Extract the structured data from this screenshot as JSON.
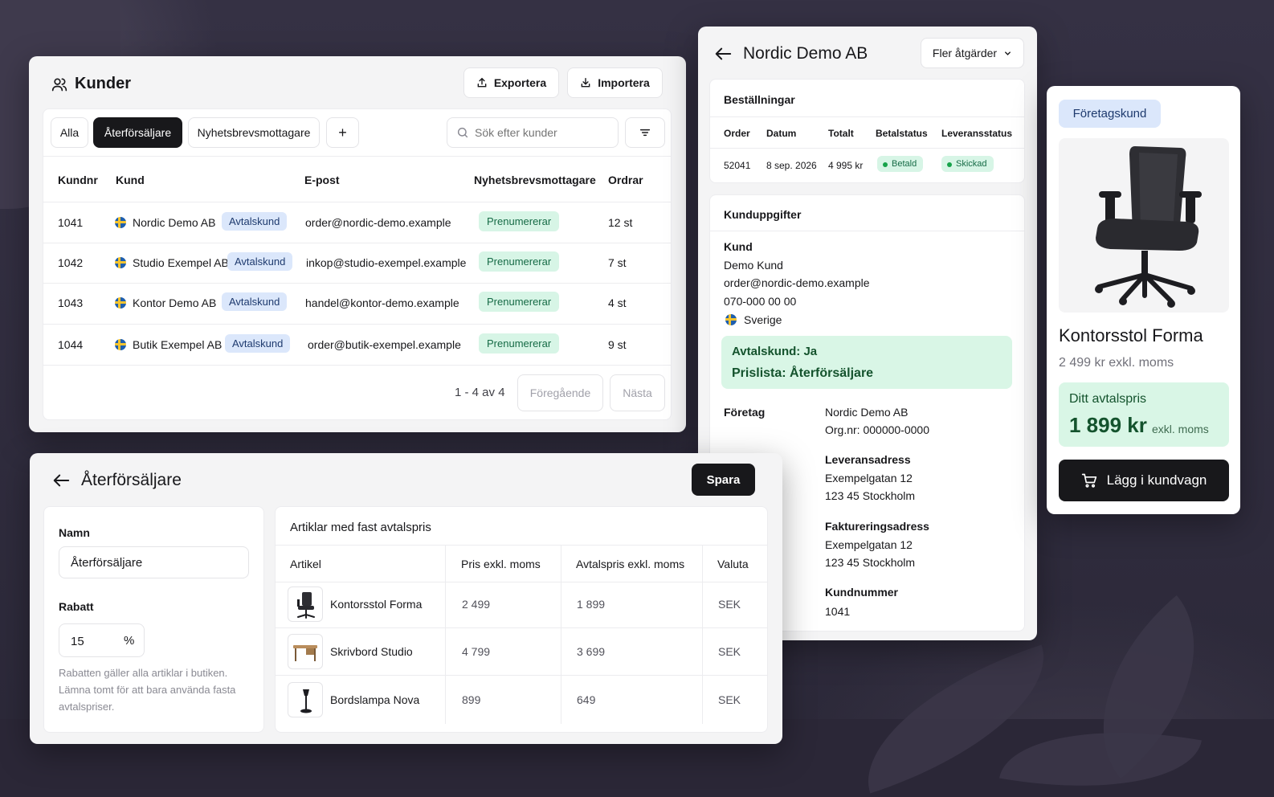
{
  "customers_panel": {
    "title": "Kunder",
    "export_label": "Exportera",
    "import_label": "Importera",
    "filters": [
      "Alla",
      "Återförsäljare",
      "Nyhetsbrevsmottagare"
    ],
    "add_filter": "+",
    "search_placeholder": "Sök efter kunder",
    "columns": [
      "Kundnr",
      "Kund",
      "E-post",
      "Nyhetsbrevsmottagare",
      "Ordrar"
    ],
    "rows": [
      {
        "id": "1041",
        "name": "Nordic Demo AB",
        "tag": "Avtalskund",
        "email": "order@nordic-demo.example",
        "newsletter": "Prenumererar",
        "orders": "12 st"
      },
      {
        "id": "1042",
        "name": "Studio Exempel AB",
        "tag": "Avtalskund",
        "email": "inkop@studio-exempel.example",
        "newsletter": "Prenumererar",
        "orders": "7 st"
      },
      {
        "id": "1043",
        "name": "Kontor Demo AB",
        "tag": "Avtalskund",
        "email": "handel@kontor-demo.example",
        "newsletter": "Prenumererar",
        "orders": "4 st"
      },
      {
        "id": "1044",
        "name": "Butik Exempel AB",
        "tag": "Avtalskund",
        "email": "order@butik-exempel.example",
        "newsletter": "Prenumererar",
        "orders": "9 st"
      }
    ],
    "pagination": {
      "range": "1 - 4 av 4",
      "prev": "Föregående",
      "next": "Nästa"
    }
  },
  "customer_detail": {
    "title": "Nordic Demo AB",
    "more_actions": "Fler åtgärder",
    "orders_heading": "Beställningar",
    "orders_columns": [
      "Order",
      "Datum",
      "Totalt",
      "Betalstatus",
      "Leveransstatus"
    ],
    "order": {
      "id": "52041",
      "date": "8 sep. 2026",
      "total": "4 995 kr",
      "payment": "Betald",
      "delivery": "Skickad"
    },
    "details_heading": "Kunduppgifter",
    "kund_label": "Kund",
    "kund_name": "Demo Kund",
    "kund_email": "order@nordic-demo.example",
    "kund_phone": "070-000 00 00",
    "kund_country": "Sverige",
    "agreement": "Avtalskund: Ja",
    "pricelist": "Prislista: Återförsäljare",
    "company_label": "Företag",
    "company_name": "Nordic Demo AB",
    "org_nr": "Org.nr: 000000-0000",
    "delivery_label": "Leveransadress",
    "delivery_street": "Exempelgatan 12",
    "delivery_city": "123 45 Stockholm",
    "billing_label": "Faktureringsadress",
    "billing_street": "Exempelgatan 12",
    "billing_city": "123 45 Stockholm",
    "custnum_label": "Kundnummer",
    "custnum": "1041"
  },
  "product_card": {
    "badge": "Företagskund",
    "name": "Kontorsstol Forma",
    "list_price": "2 499 kr exkl. moms",
    "deal_label": "Ditt avtalspris",
    "deal_price": "1 899 kr",
    "deal_suffix": "exkl. moms",
    "cart_button": "Lägg i kundvagn"
  },
  "pricelist_panel": {
    "title": "Återförsäljare",
    "save": "Spara",
    "name_label": "Namn",
    "name_value": "Återförsäljare",
    "discount_label": "Rabatt",
    "discount_value": "15",
    "discount_unit": "%",
    "discount_help": "Rabatten gäller alla artiklar i butiken. Lämna tomt för att bara använda fasta avtalspriser.",
    "articles_heading": "Artiklar med fast avtalspris",
    "columns": [
      "Artikel",
      "Pris exkl. moms",
      "Avtalspris exkl. moms",
      "Valuta"
    ],
    "rows": [
      {
        "name": "Kontorsstol Forma",
        "price": "2 499",
        "deal": "1 899",
        "currency": "SEK",
        "icon": "office-chair"
      },
      {
        "name": "Skrivbord Studio",
        "price": "4 799",
        "deal": "3 699",
        "currency": "SEK",
        "icon": "desk"
      },
      {
        "name": "Bordslampa Nova",
        "price": "899",
        "deal": "649",
        "currency": "SEK",
        "icon": "desk-lamp"
      }
    ]
  }
}
